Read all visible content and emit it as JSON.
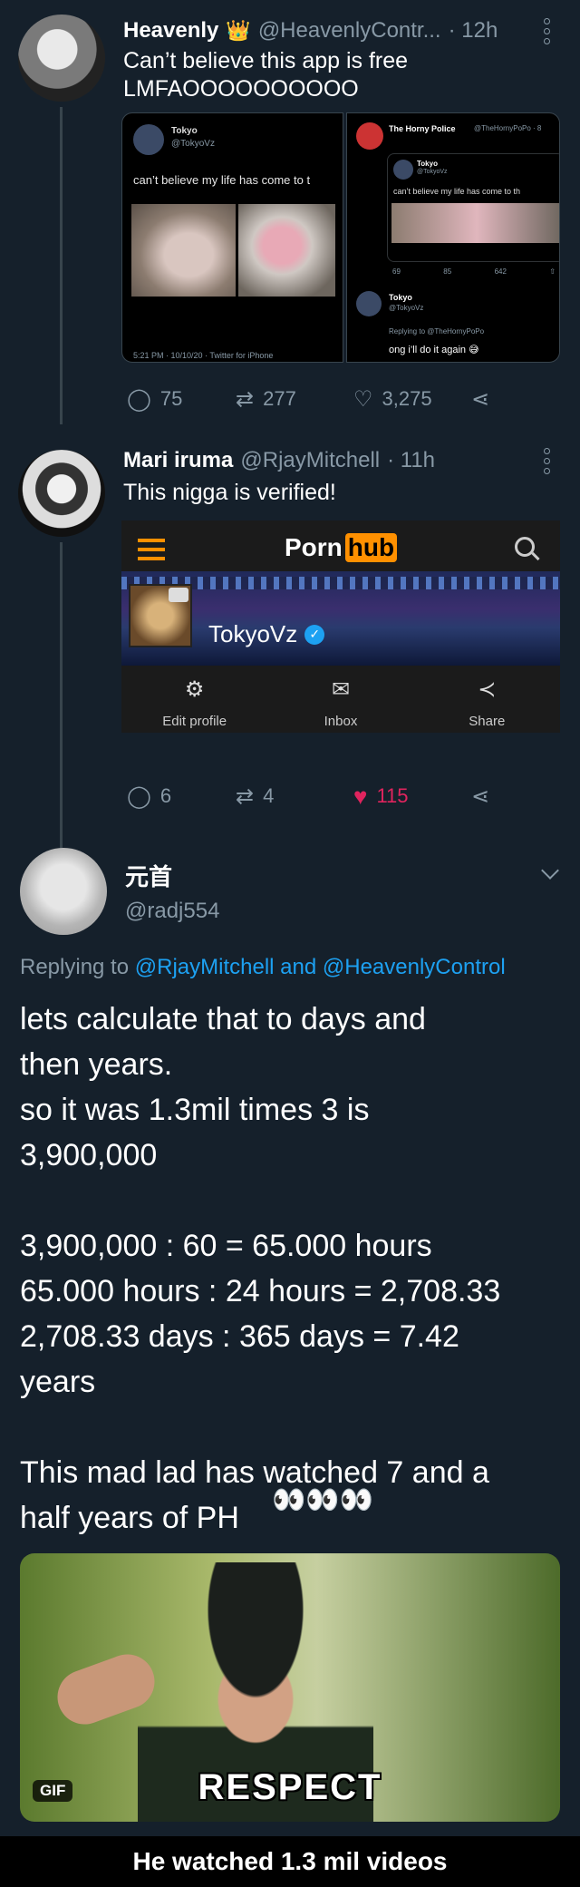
{
  "tweet1": {
    "name": "Heavenly",
    "badge_icon": "crown-emoji",
    "handle": "@HeavenlyContr...",
    "time": "· 12h",
    "text": "Can’t believe this app is free\nLMFAOOOOOOOOOO",
    "embedded_left": {
      "name": "Tokyo",
      "handle": "@TokyoVz",
      "text": "can’t believe my life has come to t",
      "footer": "5:21 PM · 10/10/20 · Twitter for iPhone"
    },
    "embedded_right": {
      "header_name": "The Horny Police",
      "header_handle": "@TheHornyPoPo · 8",
      "inner_name": "Tokyo",
      "inner_handle": "@TokyoVz",
      "inner_text": "can’t believe my life has come to th",
      "stats": [
        "69",
        "85",
        "642"
      ],
      "reply_name": "Tokyo",
      "reply_handle": "@TokyoVz",
      "replying_to": "Replying to @TheHornyPoPo",
      "reply_text": "ong i’ll do it again"
    },
    "actions": {
      "replies": "75",
      "retweets": "277",
      "likes": "3,275"
    }
  },
  "tweet2": {
    "name": "Mari iruma",
    "handle": "@RjayMitchell",
    "time": "· 11h",
    "text": "This nigga is verified!",
    "embed": {
      "logo_left": "Porn",
      "logo_right": "hub",
      "username": "TokyoVz",
      "buttons": [
        {
          "label": "Edit profile",
          "icon": "gear-icon"
        },
        {
          "label": "Inbox",
          "icon": "envelope-icon"
        },
        {
          "label": "Share",
          "icon": "share-icon"
        }
      ]
    },
    "actions": {
      "replies": "6",
      "retweets": "4",
      "likes": "115"
    },
    "colors": {
      "liked": "#e0245e",
      "ph_orange": "#ff9000"
    }
  },
  "tweet3": {
    "name": "元首",
    "handle": "@radj554",
    "replying_prefix": "Replying to ",
    "replying_user1": "@RjayMitchell",
    "replying_and": " and ",
    "replying_user2": "@HeavenlyControl",
    "body": "lets calculate that to days and\nthen years.\nso it was 1.3mil times 3 is\n3,900,000\n\n3,900,000 : 60 = 65.000 hours\n65.000 hours : 24 hours = 2,708.33\n2,708.33 days : 365 days = 7.42\nyears\n\nThis mad lad has watched 7 and a\nhalf years of PH",
    "emoji": "eyes-emoji x3",
    "gif_badge": "GIF",
    "gif_caption": "RESPECT"
  },
  "footer_caption": "He watched 1.3 mil videos",
  "accent_color": "#1da1f2"
}
